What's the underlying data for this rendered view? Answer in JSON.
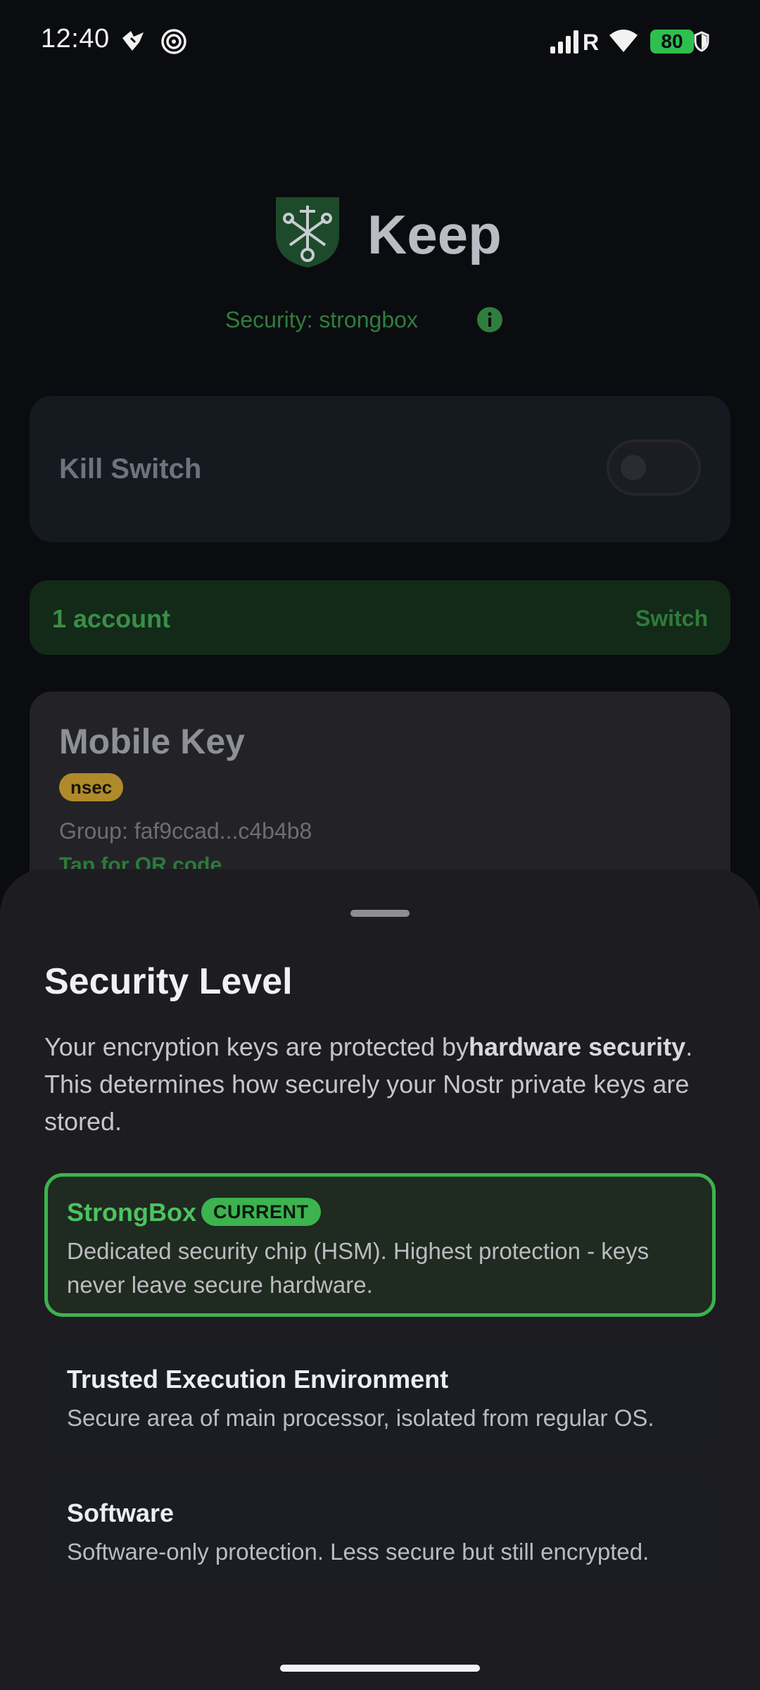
{
  "status_bar": {
    "time": "12:40",
    "carrier_indicator": "R",
    "battery": "80",
    "icons": [
      "notification-bird-icon",
      "target-icon",
      "signal-icon",
      "wifi-icon",
      "battery-icon",
      "shield-icon"
    ]
  },
  "app": {
    "title": "Keep",
    "security_status": "Security: strongbox",
    "kill_switch": {
      "label": "Kill Switch",
      "enabled": false
    },
    "accounts": {
      "count_label": "1 account",
      "switch_label": "Switch"
    },
    "key_card": {
      "name": "Mobile Key",
      "type_badge": "nsec",
      "group": "Group: faf9ccad...c4b4b8",
      "qr_hint": "Tap for QR code"
    }
  },
  "sheet": {
    "title": "Security Level",
    "description_prefix": "Your encryption keys are protected by",
    "description_bold": "hardware security",
    "description_suffix": ". This determines how securely your Nostr private keys are stored.",
    "options": [
      {
        "title": "StrongBox",
        "badge": "CURRENT",
        "description": "Dedicated security chip (HSM). Highest protection - keys never leave secure hardware."
      },
      {
        "title": "Trusted Execution Environment",
        "description": "Secure area of main processor, isolated from regular OS."
      },
      {
        "title": "Software",
        "description": "Software-only protection. Less secure but still encrypted."
      }
    ]
  },
  "colors": {
    "accent_green": "#3cb34f",
    "nsec_badge": "#b08a2a",
    "background": "#0b0c0f",
    "sheet": "#1d1c20"
  }
}
